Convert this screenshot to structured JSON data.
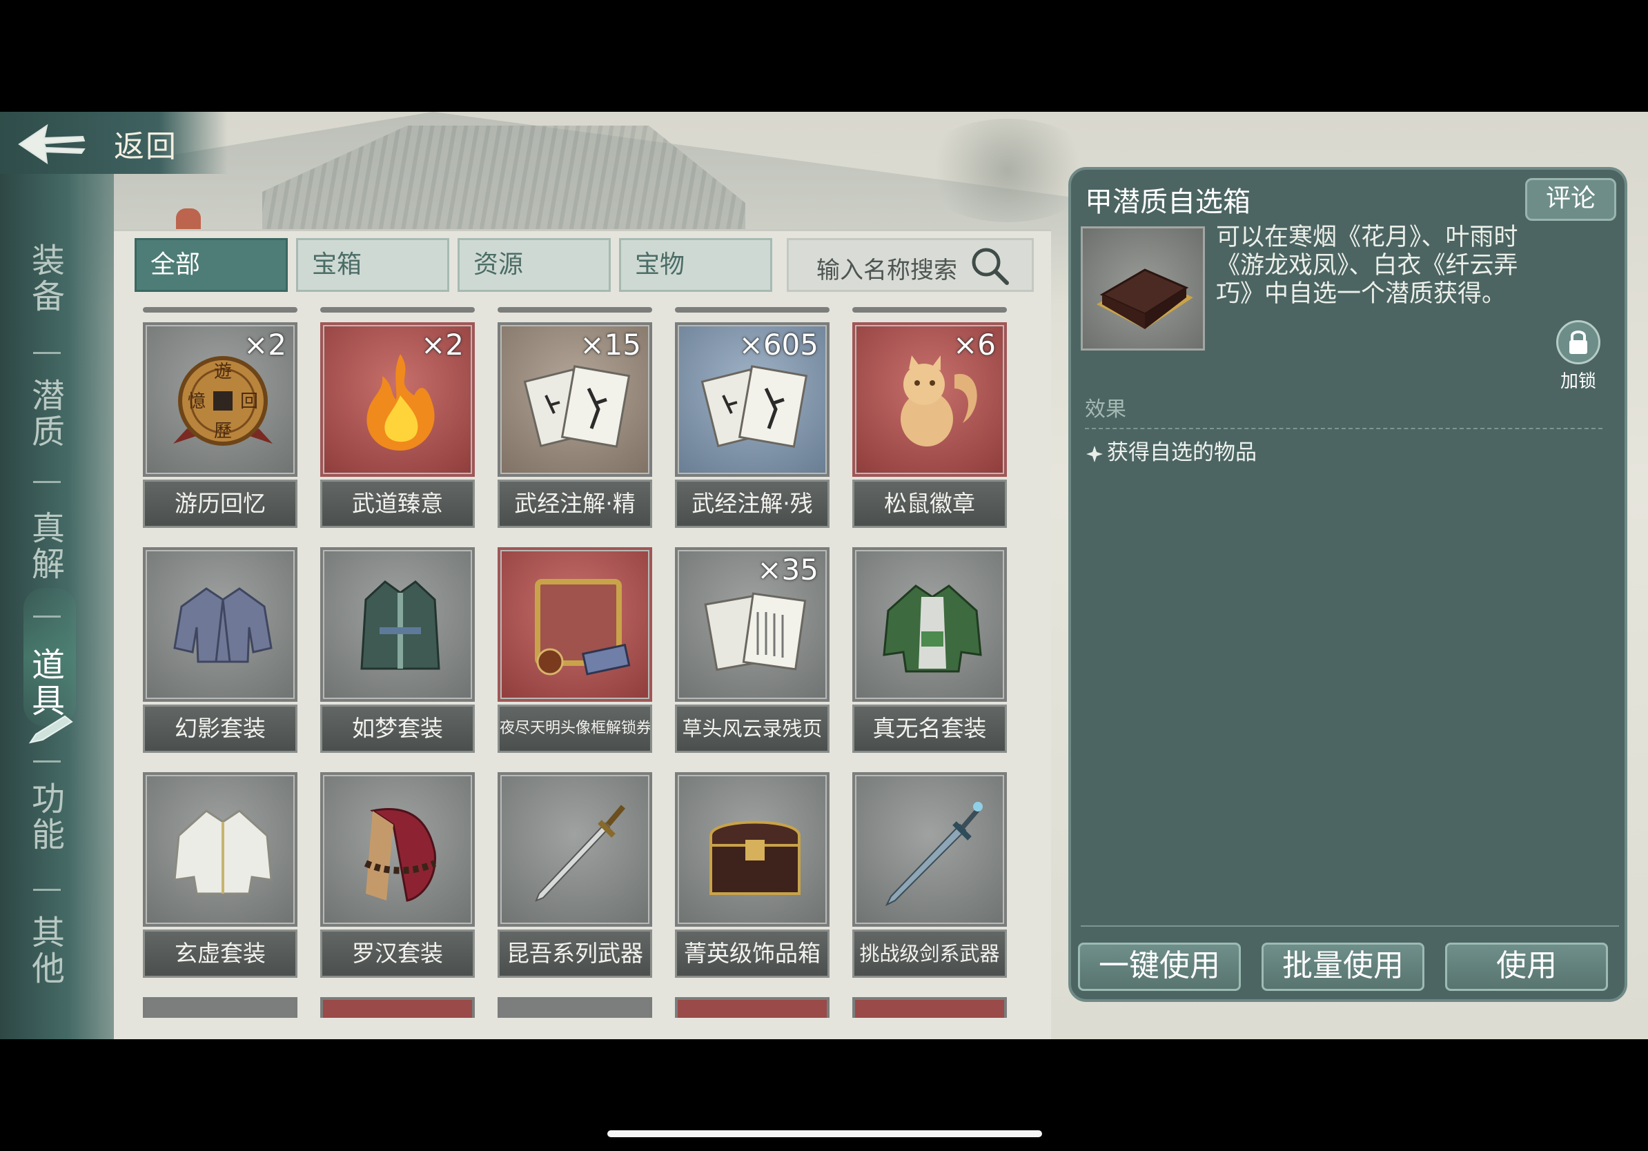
{
  "header": {
    "back_label": "返回"
  },
  "rail": {
    "items": [
      {
        "label": "装备",
        "active": false
      },
      {
        "label": "潜质",
        "active": false
      },
      {
        "label": "真解",
        "active": false
      },
      {
        "label": "道具",
        "active": true
      },
      {
        "label": "功能",
        "active": false
      },
      {
        "label": "其他",
        "active": false
      }
    ]
  },
  "tabs": [
    {
      "label": "全部",
      "active": true
    },
    {
      "label": "宝箱",
      "active": false
    },
    {
      "label": "资源",
      "active": false
    },
    {
      "label": "宝物",
      "active": false
    }
  ],
  "search": {
    "placeholder": "输入名称搜索"
  },
  "items": [
    {
      "name": "游历回忆",
      "count": "×2",
      "bg": "grey",
      "icon": "coin-icon"
    },
    {
      "name": "武道臻意",
      "count": "×2",
      "bg": "red",
      "icon": "flame-icon"
    },
    {
      "name": "武经注解·精",
      "count": "×15",
      "bg": "brown",
      "icon": "scroll-icon"
    },
    {
      "name": "武经注解·残",
      "count": "×605",
      "bg": "blue",
      "icon": "scroll-icon"
    },
    {
      "name": "松鼠徽章",
      "count": "×6",
      "bg": "red",
      "icon": "squirrel-badge-icon"
    },
    {
      "name": "幻影套装",
      "count": "",
      "bg": "grey",
      "icon": "robe-icon"
    },
    {
      "name": "如梦套装",
      "count": "",
      "bg": "grey",
      "icon": "robe-icon"
    },
    {
      "name": "夜尽天明头像框解锁券",
      "count": "",
      "bg": "red",
      "icon": "avatar-frame-icon"
    },
    {
      "name": "草头风云录残页",
      "count": "×35",
      "bg": "grey",
      "icon": "pages-icon"
    },
    {
      "name": "真无名套装",
      "count": "",
      "bg": "grey",
      "icon": "robe-icon"
    },
    {
      "name": "玄虚套装",
      "count": "",
      "bg": "grey",
      "icon": "robe-icon"
    },
    {
      "name": "罗汉套装",
      "count": "",
      "bg": "grey",
      "icon": "robe-icon"
    },
    {
      "name": "昆吾系列武器",
      "count": "",
      "bg": "grey",
      "icon": "sword-icon"
    },
    {
      "name": "菁英级饰品箱",
      "count": "",
      "bg": "grey",
      "icon": "chest-icon"
    },
    {
      "name": "挑战级剑系武器",
      "count": "",
      "bg": "grey",
      "icon": "sword-icon"
    }
  ],
  "detail": {
    "title": "甲潜质自选箱",
    "comment_label": "评论",
    "description": "可以在寒烟《花月》、叶雨时《游龙戏凤》、白衣《纤云弄巧》中自选一个潜质获得。",
    "lock_label": "加锁",
    "effect_heading": "效果",
    "effect_text": "获得自选的物品",
    "buttons": {
      "one_click": "一键使用",
      "batch": "批量使用",
      "use": "使用"
    }
  },
  "colors": {
    "accent_teal": "#4d7d76",
    "panel": "#4c6562",
    "slot_red": "#8f3d3c"
  }
}
